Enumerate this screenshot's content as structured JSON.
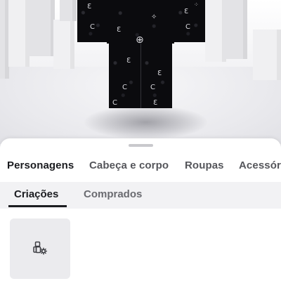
{
  "scene": {
    "background_color": "#f2f2f4",
    "outfit_color": "#0b0b0e"
  },
  "category_tabs": {
    "items": [
      {
        "label": "Personagens",
        "active": true
      },
      {
        "label": "Cabeça e corpo",
        "active": false
      },
      {
        "label": "Roupas",
        "active": false
      },
      {
        "label": "Acessórios",
        "active": false
      }
    ]
  },
  "sub_tabs": {
    "items": [
      {
        "label": "Criações",
        "active": true
      },
      {
        "label": "Comprados",
        "active": false
      }
    ]
  },
  "grid": {
    "create_card_icon": "create-character-icon"
  },
  "colors": {
    "active_text": "#1a1b1f",
    "inactive_text": "#55565b",
    "sheet_background": "#ffffff",
    "subbar_background": "#f2f2f4",
    "card_background": "#ebebee"
  }
}
